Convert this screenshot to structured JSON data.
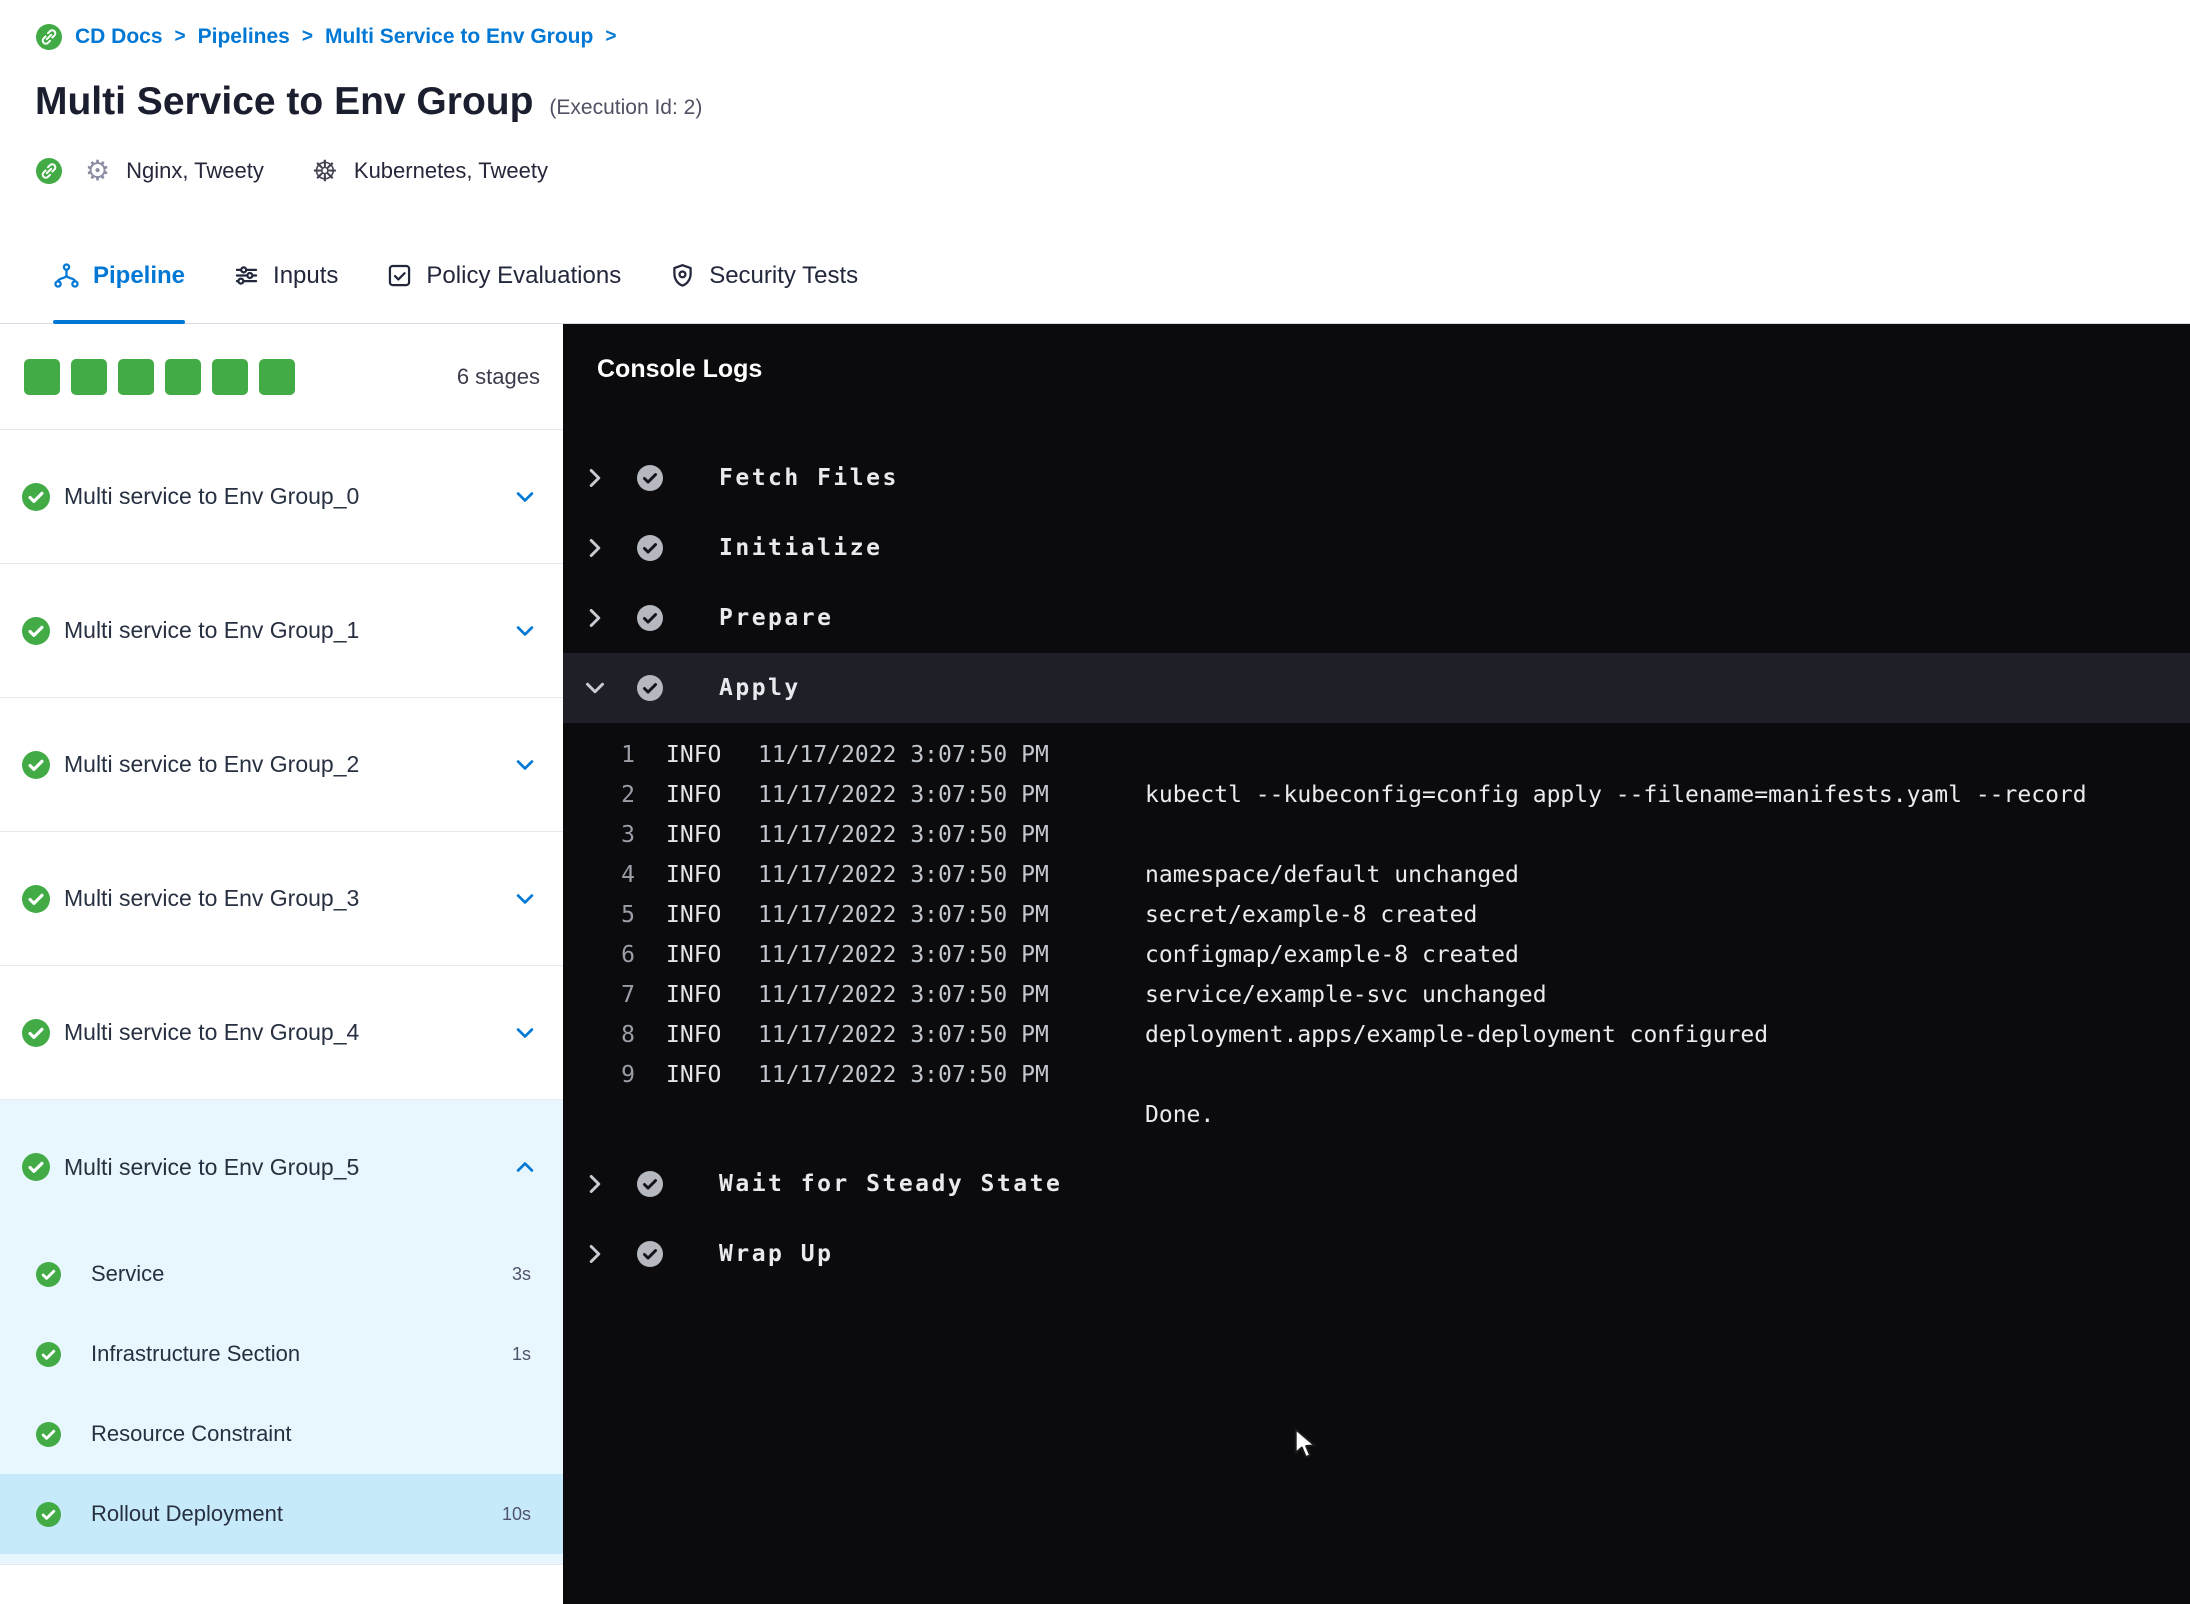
{
  "breadcrumb": {
    "separator": ">",
    "items": [
      "CD Docs",
      "Pipelines",
      "Multi Service to Env Group"
    ]
  },
  "header": {
    "title": "Multi Service to Env Group",
    "execution_id": "(Execution Id: 2)",
    "services": "Nginx, Tweety",
    "environments": "Kubernetes, Tweety"
  },
  "tabs": [
    {
      "label": "Pipeline",
      "icon": "pipeline-icon",
      "active": true
    },
    {
      "label": "Inputs",
      "icon": "inputs-icon",
      "active": false
    },
    {
      "label": "Policy Evaluations",
      "icon": "policy-check-icon",
      "active": false
    },
    {
      "label": "Security Tests",
      "icon": "shield-icon",
      "active": false
    }
  ],
  "sidebar": {
    "stage_count_label": "6 stages",
    "stage_squares": 6,
    "stages": [
      {
        "label": "Multi service to Env Group_0",
        "expanded": false
      },
      {
        "label": "Multi service to Env Group_1",
        "expanded": false
      },
      {
        "label": "Multi service to Env Group_2",
        "expanded": false
      },
      {
        "label": "Multi service to Env Group_3",
        "expanded": false
      },
      {
        "label": "Multi service to Env Group_4",
        "expanded": false
      },
      {
        "label": "Multi service to Env Group_5",
        "expanded": true,
        "steps": [
          {
            "label": "Service",
            "duration": "3s",
            "selected": false
          },
          {
            "label": "Infrastructure Section",
            "duration": "1s",
            "selected": false
          },
          {
            "label": "Resource Constraint",
            "duration": "",
            "selected": false
          },
          {
            "label": "Rollout Deployment",
            "duration": "10s",
            "selected": true
          }
        ]
      }
    ]
  },
  "console": {
    "title": "Console Logs",
    "steps": [
      {
        "name": "Fetch Files",
        "expanded": false
      },
      {
        "name": "Initialize",
        "expanded": false
      },
      {
        "name": "Prepare",
        "expanded": false
      },
      {
        "name": "Apply",
        "expanded": true,
        "logs": [
          {
            "n": "1",
            "level": "INFO",
            "time": "11/17/2022 3:07:50 PM",
            "msg": ""
          },
          {
            "n": "2",
            "level": "INFO",
            "time": "11/17/2022 3:07:50 PM",
            "msg": "kubectl --kubeconfig=config apply --filename=manifests.yaml --record"
          },
          {
            "n": "3",
            "level": "INFO",
            "time": "11/17/2022 3:07:50 PM",
            "msg": ""
          },
          {
            "n": "4",
            "level": "INFO",
            "time": "11/17/2022 3:07:50 PM",
            "msg": "namespace/default unchanged"
          },
          {
            "n": "5",
            "level": "INFO",
            "time": "11/17/2022 3:07:50 PM",
            "msg": "secret/example-8 created"
          },
          {
            "n": "6",
            "level": "INFO",
            "time": "11/17/2022 3:07:50 PM",
            "msg": "configmap/example-8 created"
          },
          {
            "n": "7",
            "level": "INFO",
            "time": "11/17/2022 3:07:50 PM",
            "msg": "service/example-svc unchanged"
          },
          {
            "n": "8",
            "level": "INFO",
            "time": "11/17/2022 3:07:50 PM",
            "msg": "deployment.apps/example-deployment configured"
          },
          {
            "n": "9",
            "level": "INFO",
            "time": "11/17/2022 3:07:50 PM",
            "msg": ""
          },
          {
            "n": "",
            "level": "",
            "time": "",
            "msg": "Done."
          }
        ]
      },
      {
        "name": "Wait for Steady State",
        "expanded": false
      },
      {
        "name": "Wrap Up",
        "expanded": false
      }
    ]
  },
  "colors": {
    "accent_blue": "#0278d5",
    "success_green": "#42ab45",
    "console_bg": "#0b0b0d",
    "expanded_stage_bg": "#e8f7fe",
    "selected_step_bg": "#c7eafa"
  }
}
